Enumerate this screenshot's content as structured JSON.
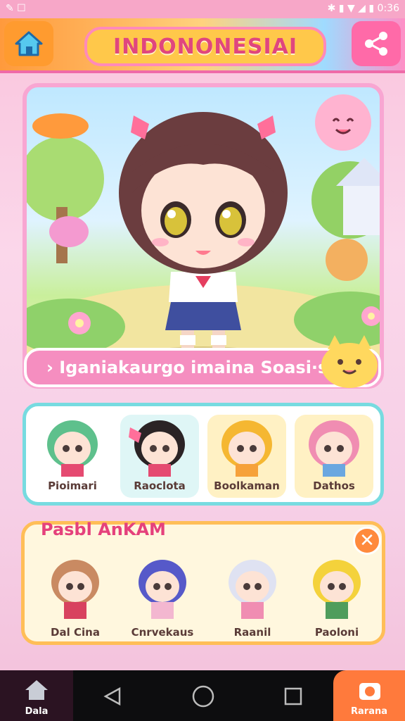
{
  "status": {
    "right_time": "0:36"
  },
  "header": {
    "title": "INDONONESIAI",
    "home_icon": "home-icon",
    "share_icon": "share-icon"
  },
  "hero": {
    "banner_text": "› Iganiakaurgo imaina Soasi·s ✦"
  },
  "characters_row1": [
    {
      "label": "Pioimari",
      "hair": "#5ec08c",
      "bg": "#ffffff"
    },
    {
      "label": "Raoclota",
      "hair": "#2b2325",
      "bg": "#dff6f6"
    },
    {
      "label": "Boolkaman",
      "hair": "#f5b731",
      "bg": "#fff1c4"
    },
    {
      "label": "Dathos",
      "hair": "#f08db2",
      "bg": "#fff1c4"
    }
  ],
  "section2": {
    "title": "Pasbl AnKAM",
    "close_label": "✕"
  },
  "characters_row2": [
    {
      "label": "Dal Cina",
      "hair": "#c98a62"
    },
    {
      "label": "Cnrvekaus",
      "hair": "#5659c9"
    },
    {
      "label": "Raanil",
      "hair": "#dfe2f2"
    },
    {
      "label": "Paoloni",
      "hair": "#f4d23b"
    }
  ],
  "nav": {
    "left_label": "Dala",
    "right_label": "Rarana"
  },
  "colors": {
    "accent_pink": "#f58ec0",
    "accent_orange": "#ff9b2f",
    "accent_teal": "#77dbe0"
  }
}
